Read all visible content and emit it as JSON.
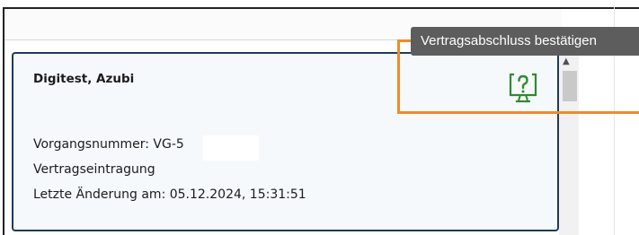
{
  "card": {
    "title": "Digitest, Azubi",
    "vorgangsnummer": "Vorgangsnummer: VG-5",
    "vertragsart": "Vertragseintragung",
    "letzte_aenderung": "Letzte Änderung am: 05.12.2024, 15:31:51"
  },
  "tooltip": {
    "text": "Vertragsabschluss bestätigen"
  },
  "colors": {
    "card_border": "#1f3a5c",
    "icon_green": "#2e8b2e",
    "highlight_orange": "#f08a2c",
    "tooltip_bg": "#5d5d5d"
  },
  "icons": {
    "confirm": "monitor-question-icon",
    "scroll_up": "chevron-up-icon"
  }
}
